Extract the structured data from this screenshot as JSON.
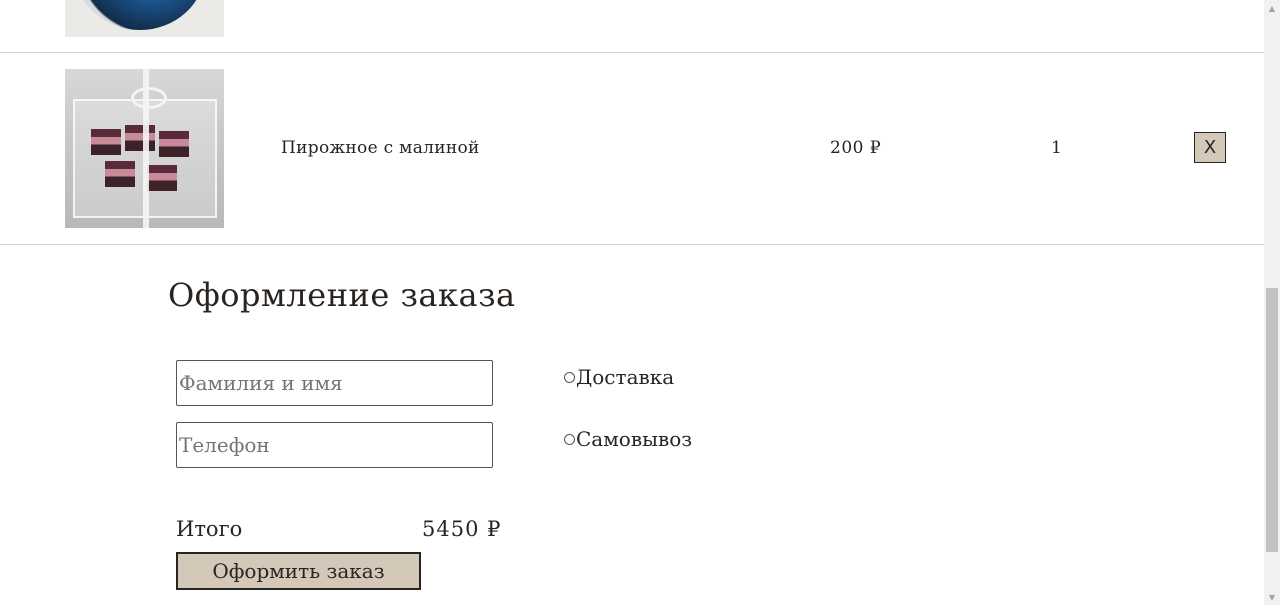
{
  "cart": {
    "items": [
      {
        "name": "Пирожное с малиной",
        "price": "200 ₽",
        "quantity": "1",
        "remove_label": "X"
      }
    ]
  },
  "checkout": {
    "title": "Оформление заказа",
    "name_placeholder": "Фамилия и имя",
    "phone_placeholder": "Телефон",
    "delivery_options": [
      {
        "label": "Доставка",
        "selected": false
      },
      {
        "label": "Самовывоз",
        "selected": false
      }
    ],
    "total_label": "Итого",
    "total_value": "5450 ₽",
    "submit_label": "Оформить заказ"
  },
  "colors": {
    "accent_button": "#d4c9b8",
    "text": "#2a2420",
    "divider": "#d8d2c6"
  },
  "scrollbar": {
    "up_icon": "chevron-up-icon",
    "down_icon": "chevron-down-icon"
  }
}
